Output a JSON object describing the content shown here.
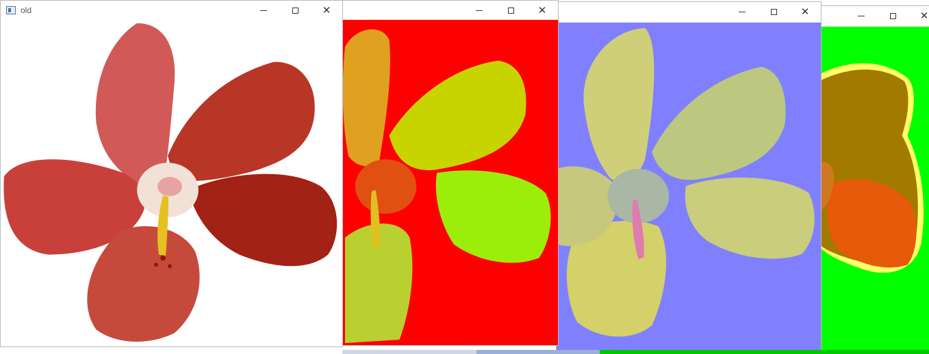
{
  "windows": {
    "old": {
      "title": "old",
      "background": "#ffffff",
      "petal_colors": [
        "#d15a58",
        "#c9403b",
        "#a22215",
        "#b83626",
        "#c64a3c"
      ]
    },
    "red_bg": {
      "title": "",
      "background": "#ff0000",
      "petal_colors": [
        "#c7d400",
        "#9ded0a",
        "#e0a020",
        "#b8d030"
      ]
    },
    "blue_bg": {
      "title": "",
      "background": "#8080ff",
      "petal_colors": [
        "#cfcf7a",
        "#bcc880",
        "#d4d06a",
        "#a9b7a4"
      ]
    },
    "green_bg": {
      "title": "",
      "background": "#00ff00",
      "petal_colors": [
        "#a37a00",
        "#e65a0a"
      ]
    }
  },
  "controls": {
    "minimize_icon": "minimize-icon",
    "maximize_icon": "maximize-icon",
    "close_icon": "close-icon",
    "close_glyph": "✕"
  }
}
